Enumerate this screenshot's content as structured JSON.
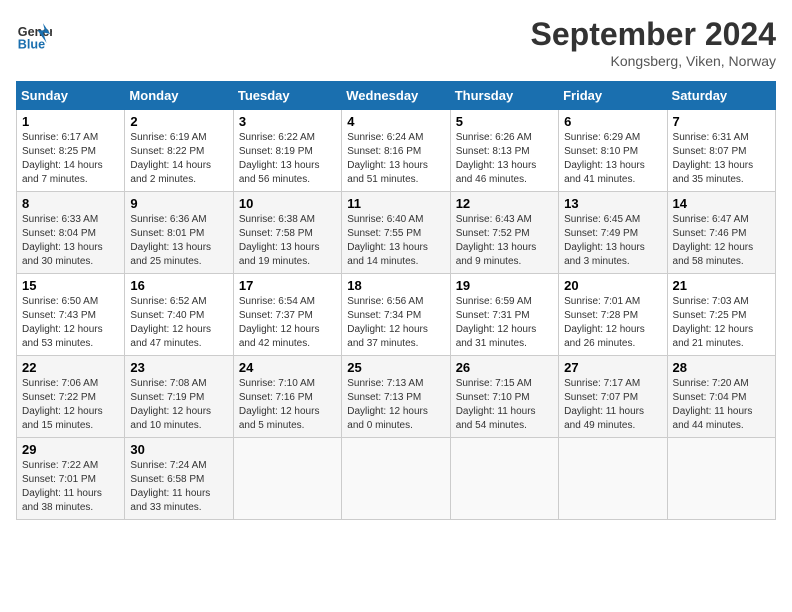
{
  "header": {
    "logo_line1": "General",
    "logo_line2": "Blue",
    "month": "September 2024",
    "location": "Kongsberg, Viken, Norway"
  },
  "columns": [
    "Sunday",
    "Monday",
    "Tuesday",
    "Wednesday",
    "Thursday",
    "Friday",
    "Saturday"
  ],
  "weeks": [
    [
      {
        "day": "1",
        "rise": "Sunrise: 6:17 AM",
        "set": "Sunset: 8:25 PM",
        "daylight": "Daylight: 14 hours and 7 minutes."
      },
      {
        "day": "2",
        "rise": "Sunrise: 6:19 AM",
        "set": "Sunset: 8:22 PM",
        "daylight": "Daylight: 14 hours and 2 minutes."
      },
      {
        "day": "3",
        "rise": "Sunrise: 6:22 AM",
        "set": "Sunset: 8:19 PM",
        "daylight": "Daylight: 13 hours and 56 minutes."
      },
      {
        "day": "4",
        "rise": "Sunrise: 6:24 AM",
        "set": "Sunset: 8:16 PM",
        "daylight": "Daylight: 13 hours and 51 minutes."
      },
      {
        "day": "5",
        "rise": "Sunrise: 6:26 AM",
        "set": "Sunset: 8:13 PM",
        "daylight": "Daylight: 13 hours and 46 minutes."
      },
      {
        "day": "6",
        "rise": "Sunrise: 6:29 AM",
        "set": "Sunset: 8:10 PM",
        "daylight": "Daylight: 13 hours and 41 minutes."
      },
      {
        "day": "7",
        "rise": "Sunrise: 6:31 AM",
        "set": "Sunset: 8:07 PM",
        "daylight": "Daylight: 13 hours and 35 minutes."
      }
    ],
    [
      {
        "day": "8",
        "rise": "Sunrise: 6:33 AM",
        "set": "Sunset: 8:04 PM",
        "daylight": "Daylight: 13 hours and 30 minutes."
      },
      {
        "day": "9",
        "rise": "Sunrise: 6:36 AM",
        "set": "Sunset: 8:01 PM",
        "daylight": "Daylight: 13 hours and 25 minutes."
      },
      {
        "day": "10",
        "rise": "Sunrise: 6:38 AM",
        "set": "Sunset: 7:58 PM",
        "daylight": "Daylight: 13 hours and 19 minutes."
      },
      {
        "day": "11",
        "rise": "Sunrise: 6:40 AM",
        "set": "Sunset: 7:55 PM",
        "daylight": "Daylight: 13 hours and 14 minutes."
      },
      {
        "day": "12",
        "rise": "Sunrise: 6:43 AM",
        "set": "Sunset: 7:52 PM",
        "daylight": "Daylight: 13 hours and 9 minutes."
      },
      {
        "day": "13",
        "rise": "Sunrise: 6:45 AM",
        "set": "Sunset: 7:49 PM",
        "daylight": "Daylight: 13 hours and 3 minutes."
      },
      {
        "day": "14",
        "rise": "Sunrise: 6:47 AM",
        "set": "Sunset: 7:46 PM",
        "daylight": "Daylight: 12 hours and 58 minutes."
      }
    ],
    [
      {
        "day": "15",
        "rise": "Sunrise: 6:50 AM",
        "set": "Sunset: 7:43 PM",
        "daylight": "Daylight: 12 hours and 53 minutes."
      },
      {
        "day": "16",
        "rise": "Sunrise: 6:52 AM",
        "set": "Sunset: 7:40 PM",
        "daylight": "Daylight: 12 hours and 47 minutes."
      },
      {
        "day": "17",
        "rise": "Sunrise: 6:54 AM",
        "set": "Sunset: 7:37 PM",
        "daylight": "Daylight: 12 hours and 42 minutes."
      },
      {
        "day": "18",
        "rise": "Sunrise: 6:56 AM",
        "set": "Sunset: 7:34 PM",
        "daylight": "Daylight: 12 hours and 37 minutes."
      },
      {
        "day": "19",
        "rise": "Sunrise: 6:59 AM",
        "set": "Sunset: 7:31 PM",
        "daylight": "Daylight: 12 hours and 31 minutes."
      },
      {
        "day": "20",
        "rise": "Sunrise: 7:01 AM",
        "set": "Sunset: 7:28 PM",
        "daylight": "Daylight: 12 hours and 26 minutes."
      },
      {
        "day": "21",
        "rise": "Sunrise: 7:03 AM",
        "set": "Sunset: 7:25 PM",
        "daylight": "Daylight: 12 hours and 21 minutes."
      }
    ],
    [
      {
        "day": "22",
        "rise": "Sunrise: 7:06 AM",
        "set": "Sunset: 7:22 PM",
        "daylight": "Daylight: 12 hours and 15 minutes."
      },
      {
        "day": "23",
        "rise": "Sunrise: 7:08 AM",
        "set": "Sunset: 7:19 PM",
        "daylight": "Daylight: 12 hours and 10 minutes."
      },
      {
        "day": "24",
        "rise": "Sunrise: 7:10 AM",
        "set": "Sunset: 7:16 PM",
        "daylight": "Daylight: 12 hours and 5 minutes."
      },
      {
        "day": "25",
        "rise": "Sunrise: 7:13 AM",
        "set": "Sunset: 7:13 PM",
        "daylight": "Daylight: 12 hours and 0 minutes."
      },
      {
        "day": "26",
        "rise": "Sunrise: 7:15 AM",
        "set": "Sunset: 7:10 PM",
        "daylight": "Daylight: 11 hours and 54 minutes."
      },
      {
        "day": "27",
        "rise": "Sunrise: 7:17 AM",
        "set": "Sunset: 7:07 PM",
        "daylight": "Daylight: 11 hours and 49 minutes."
      },
      {
        "day": "28",
        "rise": "Sunrise: 7:20 AM",
        "set": "Sunset: 7:04 PM",
        "daylight": "Daylight: 11 hours and 44 minutes."
      }
    ],
    [
      {
        "day": "29",
        "rise": "Sunrise: 7:22 AM",
        "set": "Sunset: 7:01 PM",
        "daylight": "Daylight: 11 hours and 38 minutes."
      },
      {
        "day": "30",
        "rise": "Sunrise: 7:24 AM",
        "set": "Sunset: 6:58 PM",
        "daylight": "Daylight: 11 hours and 33 minutes."
      },
      null,
      null,
      null,
      null,
      null
    ]
  ]
}
